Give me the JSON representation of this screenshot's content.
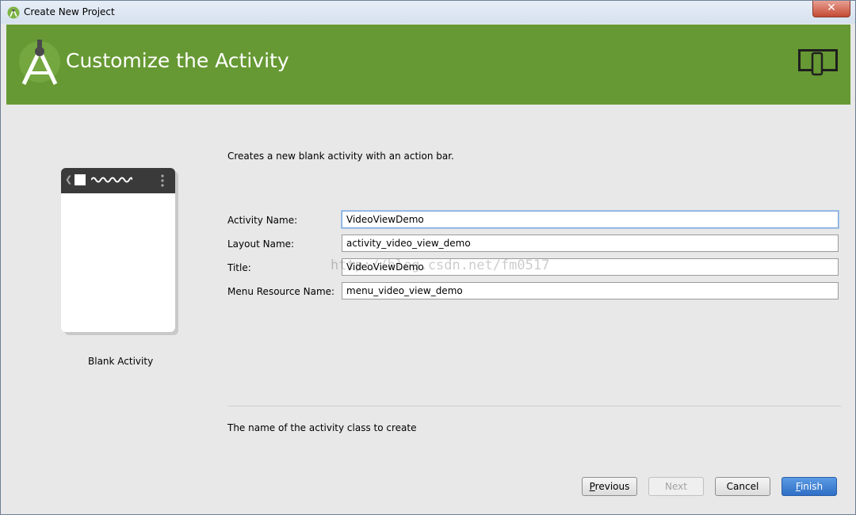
{
  "window": {
    "title": "Create New Project",
    "close_glyph": "✕"
  },
  "banner": {
    "heading": "Customize the Activity",
    "logo_icon": "android-studio-icon",
    "device_icon": "devices-icon",
    "color": "#669933"
  },
  "template": {
    "name": "Blank Activity"
  },
  "description": "Creates a new blank activity with an action bar.",
  "form": {
    "activity_name": {
      "label": "Activity Name:",
      "value": "VideoViewDemo"
    },
    "layout_name": {
      "label": "Layout Name:",
      "value": "activity_video_view_demo"
    },
    "title": {
      "label": "Title:",
      "value": "VideoViewDemo"
    },
    "menu_resource_name": {
      "label": "Menu Resource Name:",
      "value": "menu_video_view_demo"
    }
  },
  "watermark": "http://blog.csdn.net/fm0517",
  "hint": "The name of the activity class to create",
  "buttons": {
    "previous": {
      "first": "P",
      "rest": "revious"
    },
    "next": {
      "label": "Next"
    },
    "cancel": {
      "label": "Cancel"
    },
    "finish": {
      "first": "F",
      "rest": "inish"
    }
  }
}
